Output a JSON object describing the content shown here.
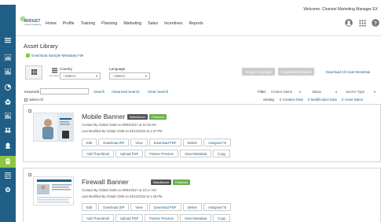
{
  "header": {
    "welcome": "Welcome: Channel Marketing Manager EX",
    "logo_name": "MIDGET",
    "logo_tagline": "channel marketing",
    "nav": [
      "Home",
      "Profile",
      "Training",
      "Planning",
      "Marketing",
      "Sales",
      "Incentives",
      "Reports"
    ]
  },
  "sidebar": {
    "icons": [
      "menu-icon",
      "chart-icon",
      "chart-icon",
      "chart-icon",
      "group-icon",
      "users-icon",
      "people-icon",
      "grid-icon",
      "org-icon",
      "user-icon",
      "document-icon",
      "gear-icon"
    ],
    "active_color": "#8ec63f",
    "bg_color": "#1f5f86"
  },
  "page": {
    "title": "Asset Library",
    "download_sample": "Download Sample Metadata File"
  },
  "filters": {
    "view_grid_label": "",
    "view_list_label": "List View",
    "country_label": "Country",
    "country_value": "--Select--",
    "language_label": "Language",
    "language_value": "--Select--",
    "assign_campaign": "Assign Campaign",
    "download_metadata": "Download Metadata",
    "download_all": "Download All Asset MetaData",
    "keyword_label": "Keywords",
    "keyword_value": "",
    "search": "Search",
    "advanced_search": "Advanced Search",
    "clear_search": "Clear Search",
    "select_all": "Select All",
    "filter_label": "Filter:",
    "filter_creator": "Creator Name",
    "filter_status": "Status",
    "filter_source": "Source Type",
    "sorting_label": "Sorting:",
    "sort_creation": "⇕ Creation Date",
    "sort_modification": "⇕ Modification Date",
    "sort_asset": "⇕ Asset Name"
  },
  "assets": [
    {
      "title": "Mobile Banner",
      "badge_type": "StaticBanner",
      "badge_status": "Published",
      "created": "Created By Global CMM on 08/04/2017 at 10:18 AM",
      "modified": "Last Modified By Global CMM on 04/12/2018 at 1:47 PM",
      "actions_row1": [
        "Edit",
        "Download ZIP",
        "View",
        "Download PDF",
        "Delete",
        "Assigned To"
      ],
      "actions_row2": [
        "Add Thumbnail",
        "Upload PDF",
        "Partner Preview",
        "View Metadata",
        "Copy"
      ]
    },
    {
      "title": "Firewall Banner",
      "badge_type": "StaticBanner",
      "badge_status": "Published",
      "created": "Created By Global CMM on 08/04/2017 at 10:17 AM",
      "modified": "Last Modified By Global CMM on 04/12/2018 at 1:46 PM",
      "actions_row1": [
        "Edit",
        "Download ZIP",
        "View",
        "Download PDF",
        "Delete",
        "Assigned To"
      ],
      "actions_row2": [
        "Add Thumbnail",
        "Upload PDF",
        "Partner Preview",
        "View Metadata",
        "Copy"
      ]
    }
  ]
}
